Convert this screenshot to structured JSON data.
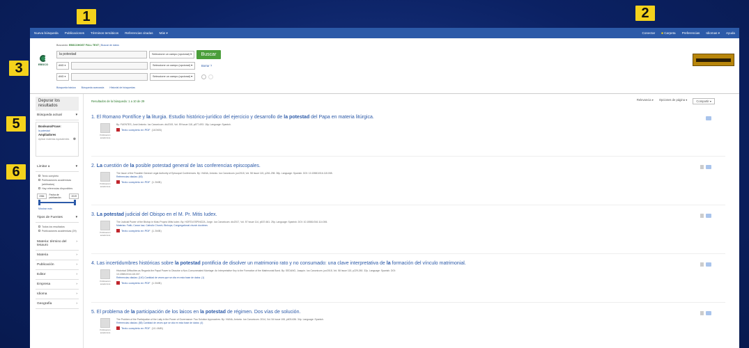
{
  "callouts": [
    "1",
    "2",
    "3",
    "4",
    "5",
    "6"
  ],
  "nav_left": [
    "Nueva búsqueda",
    "Publicaciones",
    "Términos temáticos",
    "Referencias citadas",
    "Más"
  ],
  "nav_right": [
    "Conectar",
    "Carpeta",
    "Preferencias",
    "Idiomas",
    "Ayuda"
  ],
  "search": {
    "meta_label": "Buscando:",
    "meta_db": "EBSCOHOST FULL TEXT",
    "meta_link": "Buscar de datos",
    "query": "la potestad",
    "field_select": "Seleccione un campo (opcional)",
    "bool_and": "AND",
    "button": "Buscar",
    "clear": "Borrar",
    "help": "?",
    "links": [
      "Búsqueda básica",
      "Búsqueda avanzada",
      "Historial de búsquedas"
    ]
  },
  "sidebar": {
    "refine": "Depurar los resultados",
    "current_search": "Búsqueda actual",
    "boolean_label": "Booleano/Frase:",
    "boolean_value": "la potestad",
    "expanders_label": "Ampliadores",
    "expanders_value": "Aplicar materias equivalentes",
    "limit_to": "Limitar a",
    "limit_options": [
      "Texto completo",
      "Publicaciones académicas (arbitradas)",
      "Hay referencias disponibles"
    ],
    "date_from": "1984",
    "date_to": "2019",
    "date_label": "Fecha de publicación",
    "show_more": "Mostrar más",
    "source_types": "Tipos de Fuentes",
    "source_options": [
      "Todos los resultados",
      "Publicaciones académicas (29)"
    ],
    "facets": [
      "Materia: término del tesauro",
      "Materia",
      "Publicación",
      "Editor",
      "Empresa",
      "Idioma",
      "Geografía"
    ]
  },
  "results_header": {
    "count": "Resultados de la búsqueda: 1 a 10 de 29",
    "relevance": "Relevancia",
    "page_options": "Opciones de página",
    "share": "Compartir"
  },
  "results": [
    {
      "num": "1.",
      "pre": "El Romano Pontífice y ",
      "b1": "la",
      "mid": " liturgia. Estudio histórico-jurídico del ejercicio y desarrollo de ",
      "b2": "la potestad",
      "post": " del Papa en materia litúrgica.",
      "info": "By: FUENTES, José Antonio. Ius Canonicum. dic2019, Vol. 59 Issue 118, p677-693. 18p. Language: Spanish.",
      "cited": "",
      "pdf": "Texto completo en PDF",
      "size": "(163KB)",
      "type": "Publicación académica"
    },
    {
      "num": "2.",
      "pre": "",
      "b1": "La",
      "mid": " cuestión de ",
      "b2": "la",
      "post": " posible potestad general de las conferencias episcopales.",
      "info": "The Issue of the Possible General Legal Authority of Episcopal Conferences. By: VIANA, Antonio. Ius Canonicum. jun2018, Vol. 58 Issue 115, p261-298. 38p. Language: Spanish. DOI: 10.15581/016.115.008.",
      "cited": "Referencias citadas: (63)",
      "pdf": "Texto completo en PDF",
      "size": "(1.3MB)",
      "type": "Publicación académica"
    },
    {
      "num": "3.",
      "pre": "",
      "b1": "La potestad",
      "mid": " judicial del Obispo en el M. Pr. Mitis Iudex.",
      "b2": "",
      "post": "",
      "info": "The Judicial Power of the Bishop in Motu Proprio Mitis Iudex. By: HORTA ESPINOZA, Jorge. Ius Canonicum. dic2017, Vol. 57 Issue 114, p637-661. 25p. Language: Spanish. DOI: 10.15581/016.114.006.",
      "cited": "Materias: Faith; Canon law; Catholic Church; Bishops; Congregational church doctrines",
      "pdf": "Texto completo en PDF",
      "size": "(1.3MB)",
      "type": "Publicación académica"
    },
    {
      "num": "4.",
      "pre": "Las incertidumbres históricas sobre ",
      "b1": "la potestad",
      "mid": " pontificia de disolver un matrimonio rato y no consumado: una clave interpretativa de ",
      "b2": "la",
      "post": " formación del vínculo matrimonial.",
      "info": "Historical Difficulties as Regards the Papal Power to Dissolve a Non-Consummated Marriage: An Interpretative Key to the Formation of the Matrimonial Bond. By: SEDANO, Joaquín. Ius Canonicum. jun2018, Vol. 58 Issue 115, p229-260. 32p. Language: Spanish. DOI: 10.15581/016.115.007.",
      "cited": "Referencias citadas: (140) Cantidad de veces que se cita en esta base de datos: (1)",
      "pdf": "Texto completo en PDF",
      "size": "(1.5MB)",
      "type": "Publicación académica"
    },
    {
      "num": "5.",
      "pre": "El problema de ",
      "b1": "la",
      "mid": " participación de los laicos en ",
      "b2": "la potestad",
      "post": " de régimen. Dos vías de solución.",
      "info": "The Problem of the Participation of the Laity in the Power of Governance: Two Solution Approaches. By: VIANA, Antonio. Ius Canonicum. 2014, Vol. 54 Issue 108, p603-636. 34p. Language: Spanish.",
      "cited": "Referencias citadas: (88) Cantidad de veces que se cita en esta base de datos: (4)",
      "pdf": "Texto completo en PDF",
      "size": "(10.4MB)",
      "type": "Publicación académica"
    }
  ]
}
